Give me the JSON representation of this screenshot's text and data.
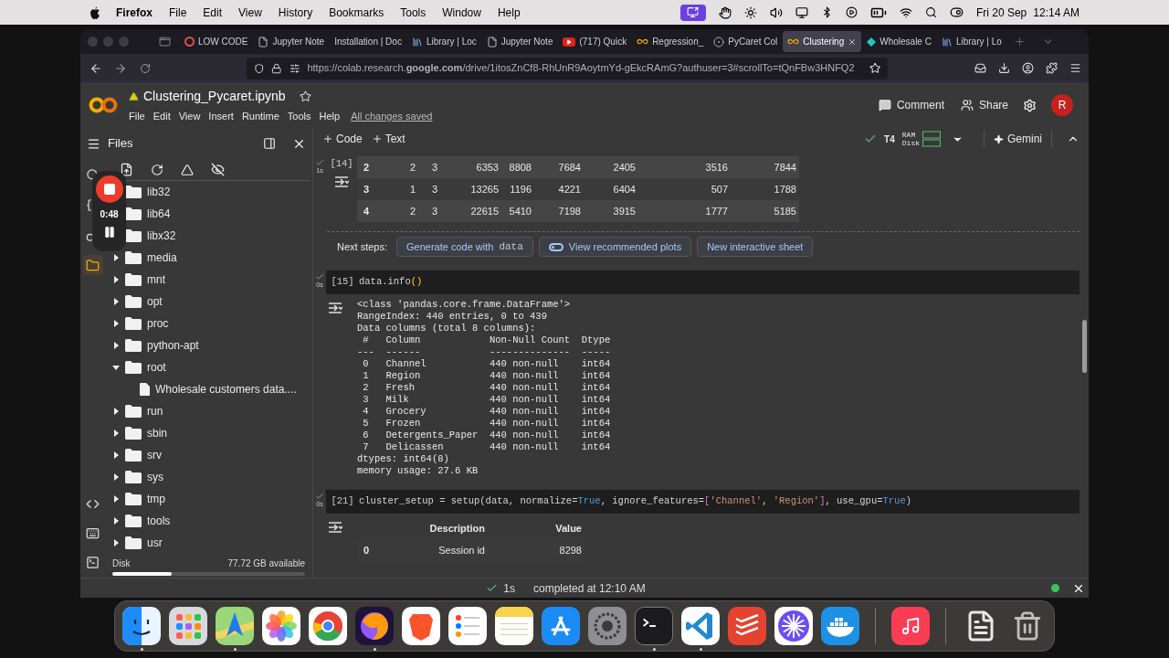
{
  "menubar": {
    "app": "Firefox",
    "menus": [
      "File",
      "Edit",
      "View",
      "History",
      "Bookmarks",
      "Tools",
      "Window",
      "Help"
    ],
    "date": "Fri 20 Sep",
    "time": "12:14 AM"
  },
  "tabs": [
    {
      "label": "LOW CODE",
      "kind": "ring",
      "selected": false
    },
    {
      "label": "Jupyter Note",
      "kind": "page",
      "selected": false
    },
    {
      "label": "Installation | Doc",
      "kind": "plain",
      "selected": false
    },
    {
      "label": "Library | Loc",
      "kind": "library",
      "selected": false
    },
    {
      "label": "Jupyter Note",
      "kind": "page",
      "selected": false
    },
    {
      "label": "(717) Quick",
      "kind": "video",
      "selected": false
    },
    {
      "label": "Regression_",
      "kind": "colab",
      "selected": false
    },
    {
      "label": "PyCaret Col",
      "kind": "badge",
      "selected": false
    },
    {
      "label": "Clustering",
      "kind": "colab",
      "selected": true
    },
    {
      "label": "Wholesale C",
      "kind": "k",
      "selected": false
    },
    {
      "label": "Library | Lo",
      "kind": "library",
      "selected": false
    }
  ],
  "url": "https://colab.research.**google.com**/drive/1itosZnCf8-RhUnR9AoytmYd-gEkcRAmG?authuser=3#scrollTo=tQnFBw3HNFQ2",
  "notebook": {
    "title": "Clustering_Pycaret.ipynb",
    "menus": [
      "File",
      "Edit",
      "View",
      "Insert",
      "Runtime",
      "Tools",
      "Help"
    ],
    "saved": "All changes saved"
  },
  "header_actions": {
    "comment": "Comment",
    "share": "Share",
    "avatar": "R"
  },
  "toolbar": {
    "add": [
      "Code",
      "Text"
    ],
    "runtime": "T4",
    "ram": "RAM",
    "disk": "Disk",
    "gemini": "Gemini"
  },
  "sidebar": {
    "title": "Files",
    "rail_top": [
      {
        "kind": "search",
        "selected": false
      },
      {
        "kind": "variables",
        "selected": false
      },
      {
        "kind": "secrets",
        "selected": false
      },
      {
        "kind": "files",
        "selected": true
      }
    ],
    "rail_bottom": [
      {
        "kind": "snippets",
        "selected": false
      },
      {
        "kind": "palette",
        "selected": false
      },
      {
        "kind": "terminal",
        "selected": false
      }
    ],
    "tree": [
      {
        "name": "lib32",
        "kind": "folder"
      },
      {
        "name": "lib64",
        "kind": "folder"
      },
      {
        "name": "libx32",
        "kind": "folder"
      },
      {
        "name": "media",
        "kind": "folder",
        "expanded": false
      },
      {
        "name": "mnt",
        "kind": "folder",
        "expanded": false
      },
      {
        "name": "opt",
        "kind": "folder",
        "expanded": false
      },
      {
        "name": "proc",
        "kind": "folder",
        "expanded": false
      },
      {
        "name": "python-apt",
        "kind": "folder",
        "expanded": false
      },
      {
        "name": "root",
        "kind": "folder",
        "expanded": true,
        "children": [
          {
            "name": "Wholesale customers data....",
            "kind": "file"
          }
        ]
      },
      {
        "name": "run",
        "kind": "folder",
        "expanded": false
      },
      {
        "name": "sbin",
        "kind": "folder",
        "expanded": false
      },
      {
        "name": "srv",
        "kind": "folder",
        "expanded": false
      },
      {
        "name": "sys",
        "kind": "folder",
        "expanded": false
      },
      {
        "name": "tmp",
        "kind": "folder",
        "expanded": false
      },
      {
        "name": "tools",
        "kind": "folder",
        "expanded": false
      },
      {
        "name": "usr",
        "kind": "folder",
        "expanded": false
      }
    ],
    "disk_label": "Disk",
    "disk_free": "77.72 GB available",
    "level": 0.31
  },
  "recorder": {
    "time": "0:48"
  },
  "cells": [
    {
      "kind": "output",
      "exec": "[14]",
      "duration": "1s",
      "output": {
        "kind": "table",
        "rows": [
          [
            "2",
            "2",
            "3",
            "6353",
            "8808",
            "7684",
            "2405",
            "3516",
            "7844"
          ],
          [
            "3",
            "1",
            "3",
            "13265",
            "1196",
            "4221",
            "6404",
            "507",
            "1788"
          ],
          [
            "4",
            "2",
            "3",
            "22615",
            "5410",
            "7198",
            "3915",
            "1777",
            "5185"
          ]
        ]
      },
      "next_steps": {
        "label": "Next steps:",
        "actions": [
          {
            "kind": "code",
            "text": "Generate code with",
            "code": "data"
          },
          {
            "kind": "toggle",
            "text": "View recommended plots"
          },
          {
            "kind": "plain",
            "text": "New interactive sheet"
          }
        ]
      }
    },
    {
      "kind": "code",
      "exec": "[15]",
      "duration": "0s",
      "tokens": [
        {
          "kind": "plain",
          "text": "data.info"
        },
        {
          "kind": "paren",
          "text": "()"
        }
      ],
      "output": {
        "kind": "text",
        "lines": [
          "<class 'pandas.core.frame.DataFrame'>",
          "RangeIndex: 440 entries, 0 to 439",
          "Data columns (total 8 columns):",
          " #   Column            Non-Null Count  Dtype ",
          "---  ------            --------------  ----- ",
          " 0   Channel           440 non-null    int64",
          " 1   Region            440 non-null    int64",
          " 2   Fresh             440 non-null    int64",
          " 3   Milk              440 non-null    int64",
          " 4   Grocery           440 non-null    int64",
          " 5   Frozen            440 non-null    int64",
          " 6   Detergents_Paper  440 non-null    int64",
          " 7   Delicassen        440 non-null    int64",
          "dtypes: int64(8)",
          "memory usage: 27.6 KB"
        ]
      }
    },
    {
      "kind": "code",
      "exec": "[21]",
      "duration": "0s",
      "tokens": [
        {
          "kind": "plain",
          "text": "cluster_setup = setup(data, normalize="
        },
        {
          "kind": "const",
          "text": "True"
        },
        {
          "kind": "plain",
          "text": ", ignore_features="
        },
        {
          "kind": "bracket",
          "text": "["
        },
        {
          "kind": "string",
          "text": "'Channel'"
        },
        {
          "kind": "plain",
          "text": ", "
        },
        {
          "kind": "string",
          "text": "'Region'"
        },
        {
          "kind": "bracket",
          "text": "]"
        },
        {
          "kind": "plain",
          "text": ", use_gpu="
        },
        {
          "kind": "const",
          "text": "True"
        },
        {
          "kind": "plain",
          "text": ")"
        }
      ],
      "output": {
        "kind": "table",
        "columns": [
          "",
          "Description",
          "Value"
        ],
        "rows": [
          [
            "0",
            "Session id",
            "8298"
          ]
        ]
      }
    }
  ],
  "status": {
    "duration": "1s",
    "text": "completed at 12:10 AM"
  },
  "dock": [
    {
      "items": [
        {
          "kind": "finder",
          "running": true
        },
        {
          "kind": "launchpad",
          "running": false
        },
        {
          "kind": "maps",
          "running": true
        },
        {
          "kind": "photos",
          "running": false
        },
        {
          "kind": "chrome",
          "running": false
        },
        {
          "kind": "firefox",
          "running": true
        },
        {
          "kind": "brave",
          "running": false
        },
        {
          "kind": "reminders",
          "running": false
        },
        {
          "kind": "notes",
          "running": false
        },
        {
          "kind": "appstore",
          "running": false
        },
        {
          "kind": "settings",
          "running": false
        },
        {
          "kind": "terminal",
          "running": true
        },
        {
          "kind": "vscode",
          "running": true
        },
        {
          "kind": "todoist",
          "running": false
        },
        {
          "kind": "burst",
          "running": false
        },
        {
          "kind": "docker",
          "running": false
        }
      ]
    },
    {
      "items": [
        {
          "kind": "music",
          "running": false
        }
      ]
    },
    {
      "items": [
        {
          "kind": "document",
          "running": false
        },
        {
          "kind": "trash",
          "running": false
        }
      ]
    }
  ]
}
